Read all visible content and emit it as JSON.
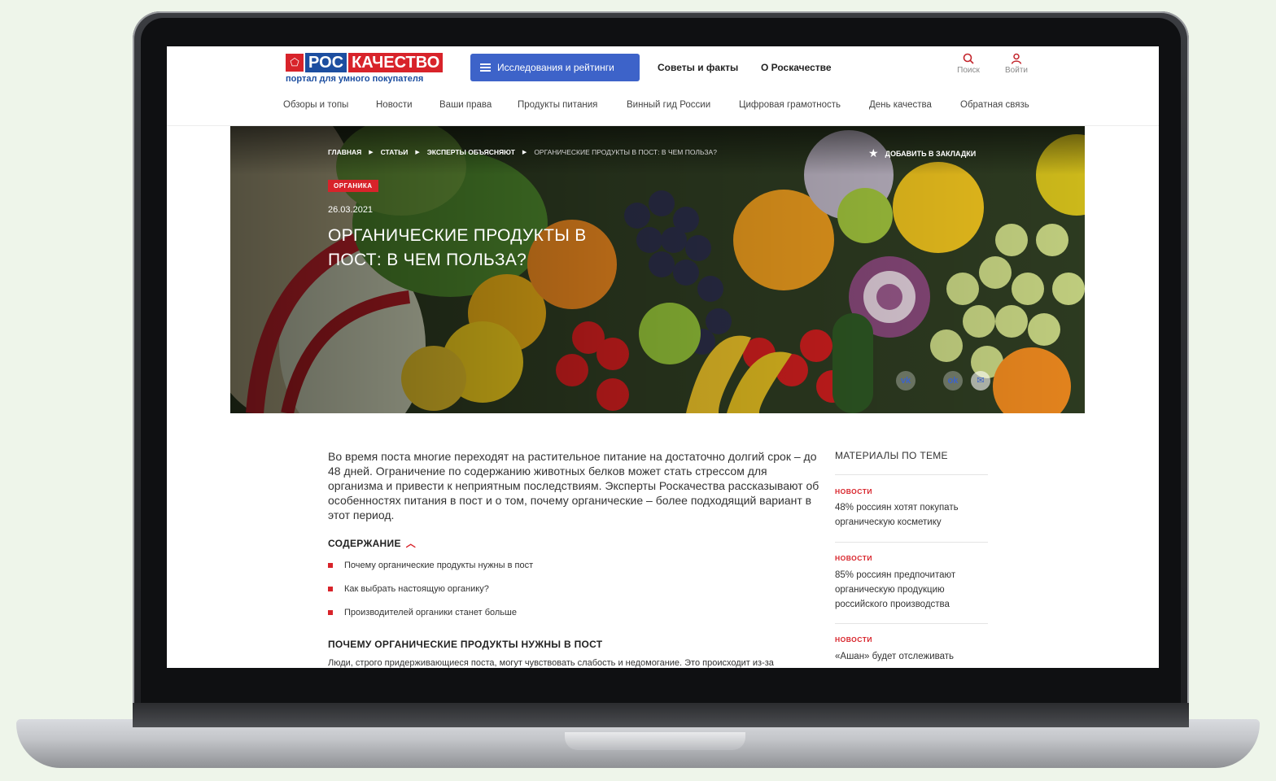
{
  "site": {
    "logo": {
      "part1": "РОС",
      "part2": "КАЧЕСТВО",
      "subtitle": "портал для умного покупателя"
    },
    "research_button": "Исследования и рейтинги",
    "top_links": [
      "Советы и факты",
      "О Роскачестве"
    ],
    "search_label": "Поиск",
    "login_label": "Войти",
    "nav": [
      "Обзоры и топы",
      "Новости",
      "Ваши права",
      "Продукты питания",
      "Винный гид России",
      "Цифровая грамотность",
      "День качества",
      "Обратная связь"
    ]
  },
  "hero": {
    "breadcrumbs": [
      "ГЛАВНАЯ",
      "СТАТЬИ",
      "ЭКСПЕРТЫ ОБЪЯСНЯЮТ"
    ],
    "breadcrumb_current": "ОРГАНИЧЕСКИЕ ПРОДУКТЫ В ПОСТ: В ЧЕМ ПОЛЬЗА?",
    "bookmark_label": "ДОБАВИТЬ В ЗАКЛАДКИ",
    "tag": "ОРГАНИКА",
    "date": "26.03.2021",
    "title": "ОРГАНИЧЕСКИЕ ПРОДУКТЫ В ПОСТ: В ЧЕМ ПОЛЬЗА?",
    "share": {
      "vk": "vk",
      "ok": "ok",
      "mail": "✉"
    }
  },
  "article": {
    "lead": "Во время поста многие переходят на растительное питание на достаточно долгий срок – до 48 дней. Ограничение по содержанию животных белков может стать стрессом для организма и привести к неприятным последствиям. Эксперты Роскачества рассказывают об особенностях питания в пост и о том, почему органические – более подходящий вариант в этот период.",
    "toc_title": "СОДЕРЖАНИЕ",
    "toc": [
      "Почему органические продукты нужны в пост",
      "Как выбрать настоящую органику?",
      "Производителей органики станет больше"
    ],
    "section_title": "ПОЧЕМУ ОРГАНИЧЕСКИЕ ПРОДУКТЫ НУЖНЫ В ПОСТ",
    "section_text": "Люди, строго придерживающиеся поста, могут чувствовать слабость и недомогание. Это происходит из-за"
  },
  "sidebar": {
    "title": "МАТЕРИАЛЫ ПО ТЕМЕ",
    "items": [
      {
        "tag": "НОВОСТИ",
        "title": "48% россиян хотят покупать органическую косметику"
      },
      {
        "tag": "НОВОСТИ",
        "title": "85% россиян предпочитают органическую продукцию российского производства"
      },
      {
        "tag": "НОВОСТИ",
        "title": "«Ашан» будет отслеживать"
      }
    ]
  },
  "colors": {
    "brand_red": "#d8232a",
    "brand_blue": "#1c4ea0",
    "button_blue": "#3d63c9"
  }
}
